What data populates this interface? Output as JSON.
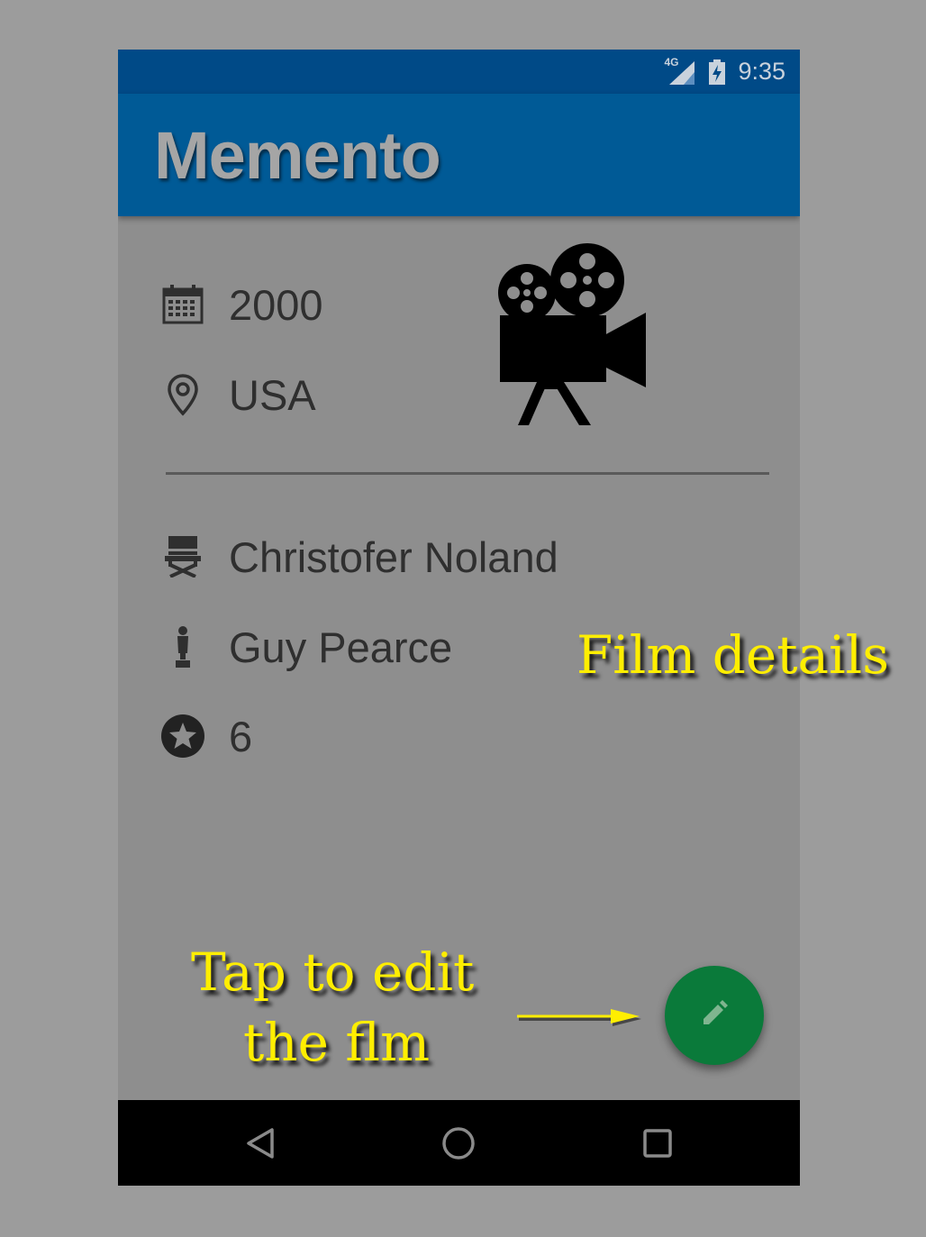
{
  "status_bar": {
    "network": "4G",
    "time": "9:35"
  },
  "app_bar": {
    "title": "Memento"
  },
  "details": {
    "year": {
      "icon": "calendar-icon",
      "value": "2000"
    },
    "country": {
      "icon": "location-pin-icon",
      "value": "USA"
    },
    "director": {
      "icon": "director-chair-icon",
      "value": "Christofer Noland"
    },
    "actor": {
      "icon": "actor-statuette-icon",
      "value": "Guy Pearce"
    },
    "rating": {
      "icon": "star-circle-icon",
      "value": "6"
    }
  },
  "film_image": {
    "icon": "movie-camera-icon"
  },
  "fab": {
    "icon": "pencil-edit-icon"
  },
  "nav_bar": {
    "back": "back-triangle-icon",
    "home": "home-circle-icon",
    "recents": "recents-square-icon"
  },
  "annotations": {
    "film_details": "Film details",
    "tap_to_edit_line1": "Tap to edit",
    "tap_to_edit_line2": "the flm"
  },
  "colors": {
    "status_bar": "#004a87",
    "app_bar": "#005a96",
    "fab": "#0a7a3a",
    "annotation": "#ffee00",
    "overlay_background": "#9c9c9c"
  }
}
